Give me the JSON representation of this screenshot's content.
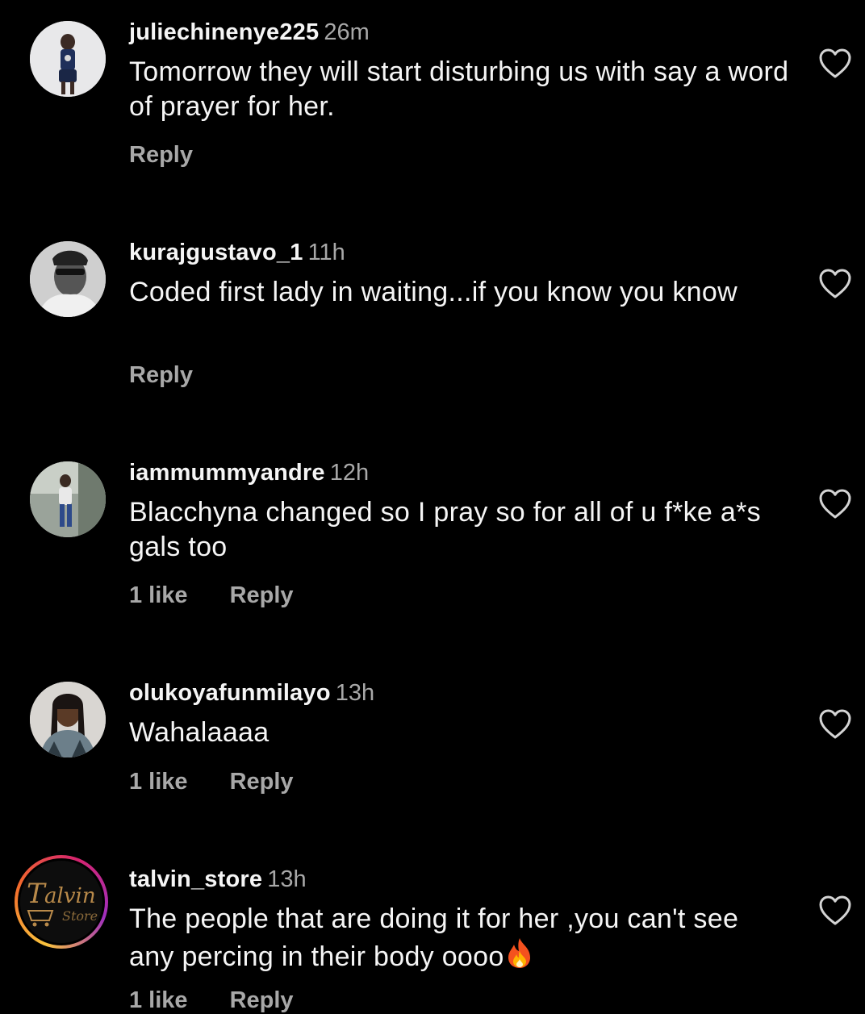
{
  "comments": [
    {
      "username": "juliechinenye225",
      "time": "26m",
      "text": "Tomorrow they will start disturbing us with say a word of prayer for her.",
      "likes": "",
      "reply": "Reply",
      "avatar_icon": "avatar-person-icon"
    },
    {
      "username": "kurajgustavo_1",
      "time": "11h",
      "text": "Coded first lady in waiting...if you know you know",
      "likes": "",
      "reply": "Reply",
      "avatar_icon": "avatar-person-icon"
    },
    {
      "username": "iammummyandre",
      "time": "12h",
      "text": "Blacchyna changed so I pray so for all of u f*ke a*s gals too",
      "likes": "1 like",
      "reply": "Reply",
      "avatar_icon": "avatar-person-icon"
    },
    {
      "username": "olukoyafunmilayo",
      "time": "13h",
      "text": "Wahalaaaa",
      "likes": "1 like",
      "reply": "Reply",
      "avatar_icon": "avatar-person-icon"
    },
    {
      "username": "talvin_store",
      "time": "13h",
      "text": "The people that are doing it for her ,you can't see any percing in their body oooo",
      "text_emoji": "fire-emoji-icon",
      "likes": "1 like",
      "reply": "Reply",
      "avatar_icon": "talvin-store-logo-icon",
      "avatar_logo_text": "Talvin Store"
    }
  ],
  "colors": {
    "background": "#000000",
    "primary_text": "#f5f5f5",
    "secondary_text": "#a8a8a8",
    "story_ring": [
      "#f9c33d",
      "#f36b2b",
      "#d6246e",
      "#a02fbf"
    ]
  }
}
